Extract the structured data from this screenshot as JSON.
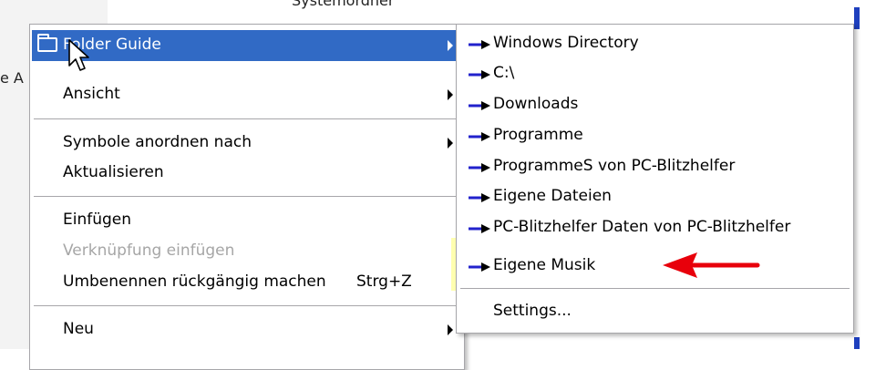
{
  "background": {
    "top_text": "Systemordner",
    "left_text": "e A"
  },
  "context_menu": {
    "items": [
      {
        "label": "Folder Guide",
        "submenu": true,
        "selected": true
      },
      {
        "label": "Ansicht",
        "submenu": true
      },
      {
        "label": "Symbole anordnen nach",
        "submenu": true
      },
      {
        "label": "Aktualisieren"
      },
      {
        "label": "Einfügen"
      },
      {
        "label": "Verknüpfung einfügen",
        "disabled": true
      },
      {
        "label": "Umbenennen rückgängig machen",
        "shortcut": "Strg+Z"
      },
      {
        "label": "Neu",
        "submenu": true
      }
    ]
  },
  "submenu": {
    "items": [
      {
        "label": "Windows Directory"
      },
      {
        "label": "C:\\"
      },
      {
        "label": "Downloads"
      },
      {
        "label": "Programme"
      },
      {
        "label": "ProgrammeS  von PC-Blitzhelfer"
      },
      {
        "label": "Eigene Dateien"
      },
      {
        "label": "PC-Blitzhelfer  Daten von PC-Blitzhelfer"
      },
      {
        "label": "Eigene Musik",
        "highlighted": true
      }
    ],
    "settings_label": "Settings..."
  },
  "colors": {
    "selection": "#316ac5",
    "highlight": "#ffff96",
    "annotation_arrow": "#e8000b",
    "item_arrow": "#2222cc"
  }
}
